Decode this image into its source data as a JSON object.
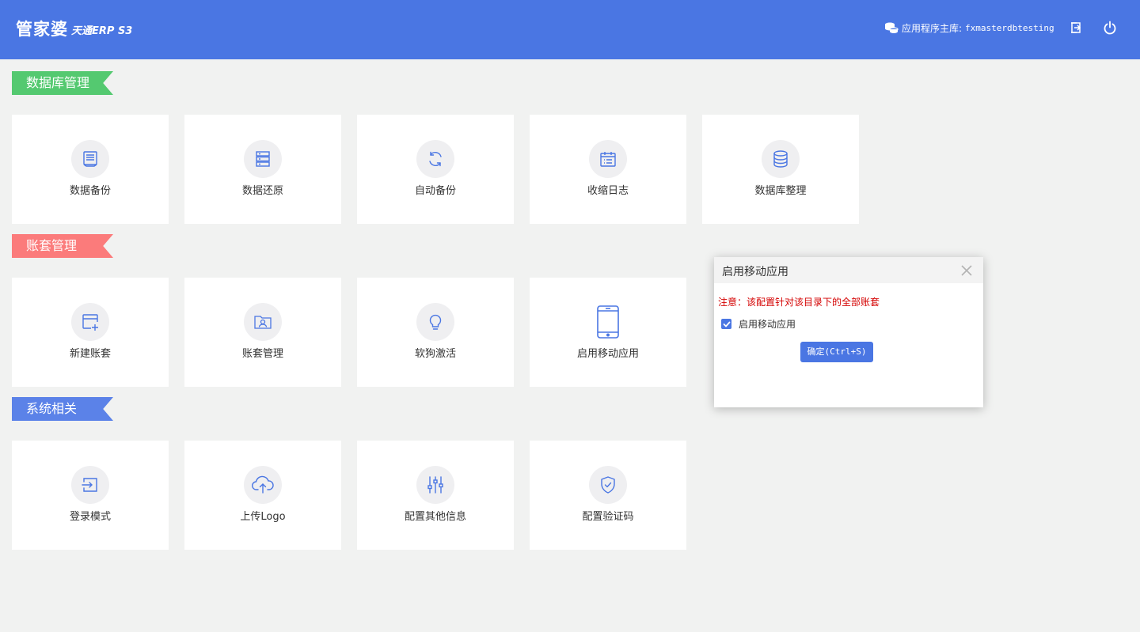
{
  "header": {
    "logo_main": "管家婆",
    "logo_sub": "天通ERP S3",
    "db_label": "应用程序主库:",
    "db_name": "fxmasterdbtesting",
    "accent_color": "#4a76e3"
  },
  "sections": {
    "database": {
      "title": "数据库管理",
      "color": "#54c970",
      "tiles": [
        {
          "label": "数据备份",
          "icon": "backup-icon"
        },
        {
          "label": "数据还原",
          "icon": "restore-icon"
        },
        {
          "label": "自动备份",
          "icon": "auto-backup-icon"
        },
        {
          "label": "收缩日志",
          "icon": "calendar-log-icon"
        },
        {
          "label": "数据库整理",
          "icon": "database-icon"
        }
      ]
    },
    "account": {
      "title": "账套管理",
      "color": "#fb7b7b",
      "tiles": [
        {
          "label": "新建账套",
          "icon": "new-account-icon"
        },
        {
          "label": "账套管理",
          "icon": "account-folder-icon"
        },
        {
          "label": "软狗激活",
          "icon": "lightbulb-icon"
        },
        {
          "label": "启用移动应用",
          "icon": "mobile-phone-icon"
        }
      ]
    },
    "system": {
      "title": "系统相关",
      "color": "#5b82e8",
      "tiles": [
        {
          "label": "登录模式",
          "icon": "login-icon"
        },
        {
          "label": "上传Logo",
          "icon": "cloud-upload-icon"
        },
        {
          "label": "配置其他信息",
          "icon": "sliders-icon"
        },
        {
          "label": "配置验证码",
          "icon": "shield-check-icon"
        }
      ]
    }
  },
  "dialog": {
    "title": "启用移动应用",
    "notice": "注意：该配置针对该目录下的全部账套",
    "checkbox_label": "启用移动应用",
    "checkbox_checked": true,
    "confirm_label": "确定(Ctrl+S)"
  }
}
